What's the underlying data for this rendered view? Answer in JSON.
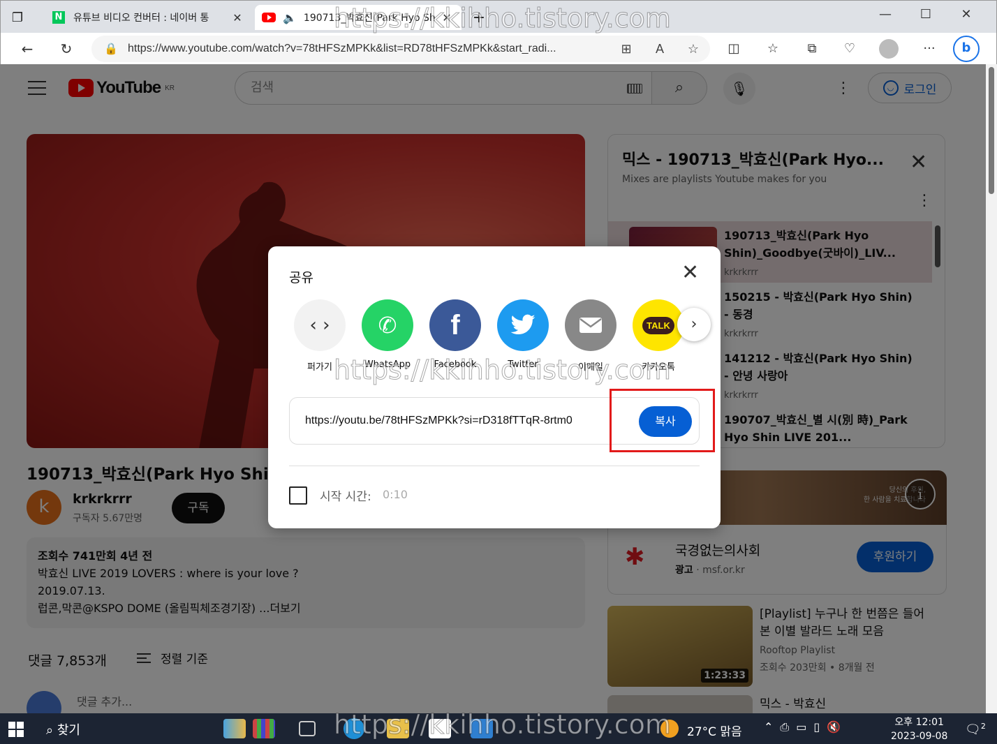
{
  "browser": {
    "tabs": [
      {
        "title": "유튜브 비디오 컨버터 : 네이버 통",
        "favicon": "naver-icon"
      },
      {
        "title": "190713_박효신(Park Hyo Sh",
        "favicon": "youtube-icon",
        "active": true
      }
    ],
    "url": "https://www.youtube.com/watch?v=78tHFSzMPKk&list=RD78tHFSzMPKk&start_radi..."
  },
  "youtube": {
    "logo": "YouTube",
    "region": "KR",
    "search_placeholder": "검색",
    "login": "로그인"
  },
  "video": {
    "title": "190713_박효신(Park Hyo Shin)_Goodbye(굿바이)_LIVE",
    "channel": "krkrkrrr",
    "channel_initial": "k",
    "subscribers": "구독자 5.67만명",
    "subscribe": "구독",
    "description": [
      "조회수 741만회 4년 전",
      "박효신 LIVE 2019 LOVERS : where is your love ?",
      "2019.07.13.",
      "럽콘,막콘@KSPO DOME (올림픽체조경기장) ...더보기"
    ],
    "comments": "댓글 7,853개",
    "sort": "정렬 기준",
    "add_comment": "댓글 추가..."
  },
  "playlist": {
    "title": "믹스 - 190713_박효신(Park Hyo...",
    "subtitle": "Mixes are playlists Youtube makes for you",
    "items": [
      {
        "title": "190713_박효신(Park Hyo Shin)_Goodbye(굿바이)_LIV...",
        "channel": "krkrkrrr"
      },
      {
        "title": "150215 - 박효신(Park Hyo Shin) - 동경",
        "channel": "krkrkrrr"
      },
      {
        "title": "141212 - 박효신(Park Hyo Shin) - 안녕 사랑아",
        "channel": "krkrkrrr"
      },
      {
        "title": "190707_박효신_별 시(別 時)_Park Hyo Shin LIVE 201...",
        "channel": ""
      }
    ]
  },
  "ad": {
    "image_text": "당신의 후원,\n한 사람을 치료합니다",
    "info": "i",
    "name": "국경없는의사회",
    "label": "광고",
    "domain": "msf.or.kr",
    "button": "후원하기"
  },
  "recommended": {
    "title": "[Playlist] 누구나 한 번쯤은 들어본 이별 발라드 노래 모음",
    "channel": "Rooftop Playlist",
    "meta": "조회수 203만회 • 8개월 전",
    "duration": "1:23:33",
    "next_title": "믹스 - 박효신"
  },
  "share_dialog": {
    "title": "공유",
    "targets": [
      {
        "label": "퍼가기",
        "icon": "embed-icon",
        "color": "#f2f2f2"
      },
      {
        "label": "WhatsApp",
        "icon": "whatsapp-icon",
        "color": "#25d366"
      },
      {
        "label": "Facebook",
        "icon": "facebook-icon",
        "color": "#3b5998"
      },
      {
        "label": "Twitter",
        "icon": "twitter-icon",
        "color": "#1d9bf0"
      },
      {
        "label": "이메일",
        "icon": "email-icon",
        "color": "#888888"
      },
      {
        "label": "카카오톡",
        "icon": "kakaotalk-icon",
        "color": "#fee500"
      }
    ],
    "link": "https://youtu.be/78tHFSzMPKk?si=rD318fTTqR-8rtm0",
    "copy": "복사",
    "start_time_label": "시작 시간:",
    "start_time_value": "0:10",
    "kakao_badge": "TALK"
  },
  "watermark": "https://kkihho.tistory.com",
  "taskbar": {
    "search": "찾기",
    "weather": "27°C 맑음",
    "time": "오후 12:01",
    "date": "2023-09-08",
    "notifications": "2"
  }
}
